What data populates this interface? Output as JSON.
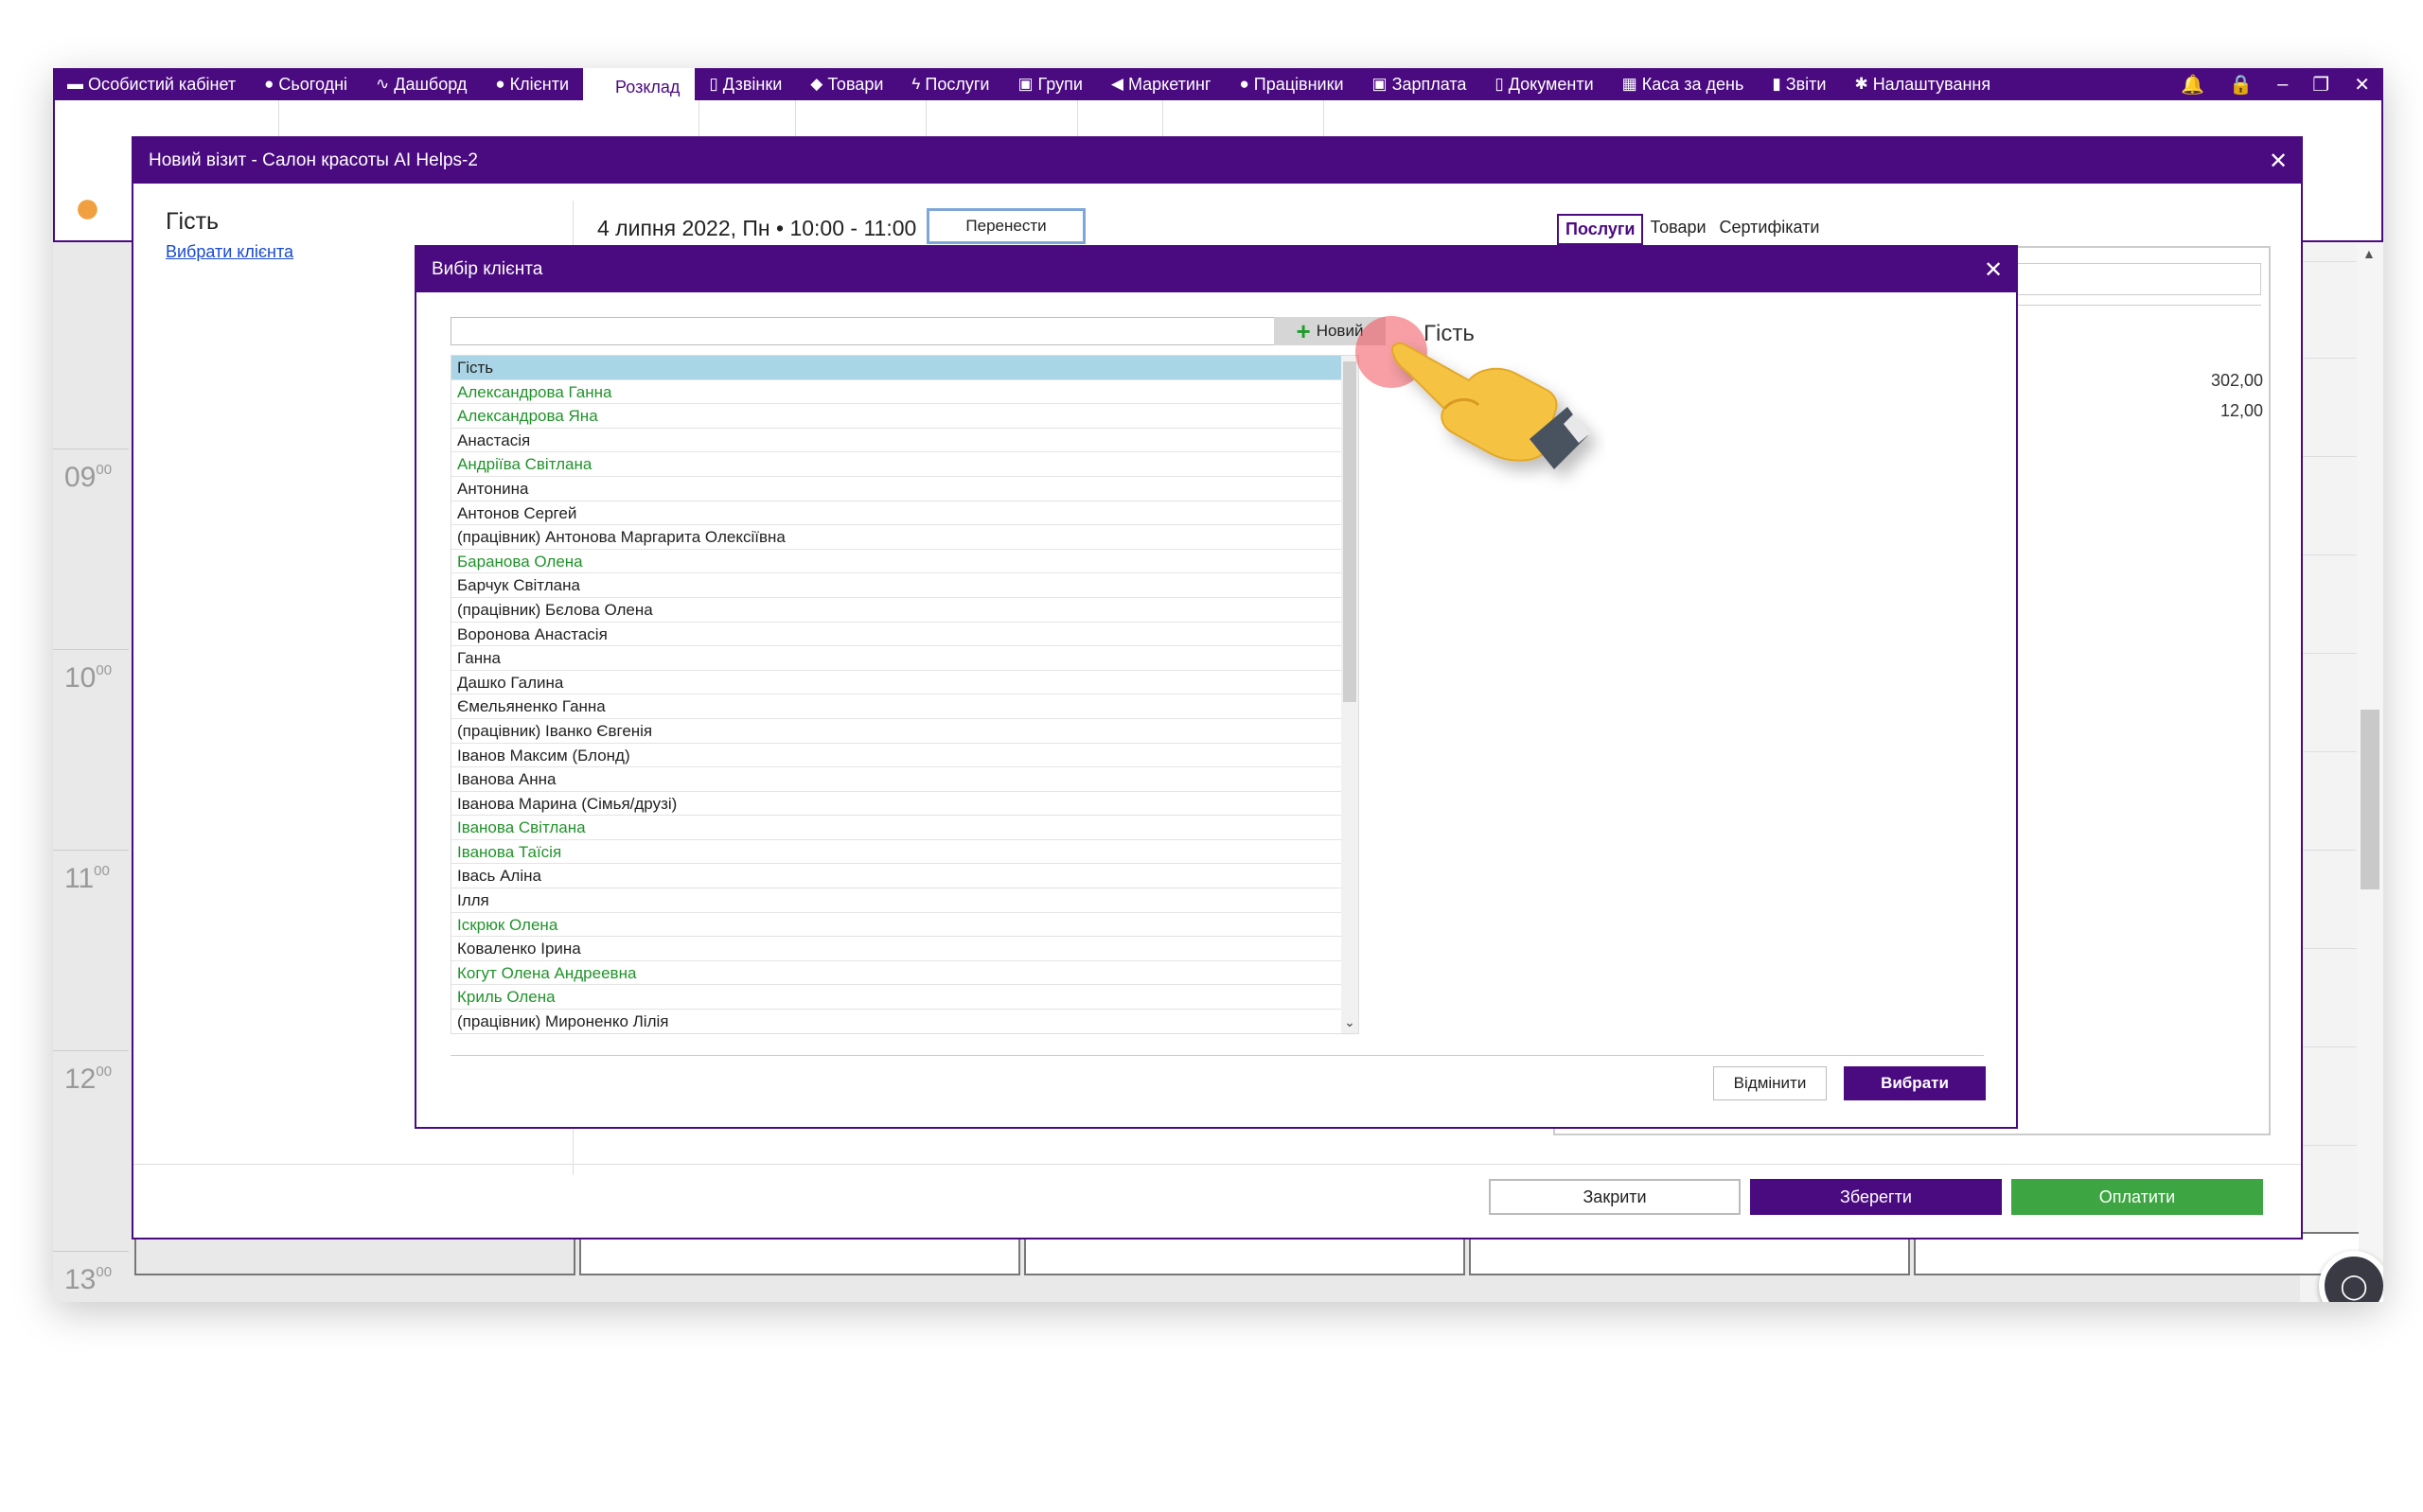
{
  "menu": {
    "items": [
      {
        "label": "Особистий кабінет",
        "icon": "briefcase-icon",
        "glyph": "▬"
      },
      {
        "label": "Сьогодні",
        "icon": "clock-icon",
        "glyph": "●"
      },
      {
        "label": "Дашборд",
        "icon": "pulse-icon",
        "glyph": "∿"
      },
      {
        "label": "Клієнти",
        "icon": "user-circle-icon",
        "glyph": "●"
      },
      {
        "label": "Розклад",
        "icon": "calendar-icon",
        "glyph": "",
        "active": true
      },
      {
        "label": "Дзвінки",
        "icon": "phone-icon",
        "glyph": "▯"
      },
      {
        "label": "Товари",
        "icon": "box-icon",
        "glyph": "◆"
      },
      {
        "label": "Послуги",
        "icon": "lightning-icon",
        "glyph": "ϟ"
      },
      {
        "label": "Групи",
        "icon": "group-icon",
        "glyph": "▣"
      },
      {
        "label": "Маркетинг",
        "icon": "megaphone-icon",
        "glyph": "◀"
      },
      {
        "label": "Працівники",
        "icon": "person-icon",
        "glyph": "●"
      },
      {
        "label": "Зарплата",
        "icon": "money-icon",
        "glyph": "▣"
      },
      {
        "label": "Документи",
        "icon": "document-icon",
        "glyph": "▯"
      },
      {
        "label": "Каса за день",
        "icon": "cash-register-icon",
        "glyph": "▦"
      },
      {
        "label": "Звіти",
        "icon": "bar-chart-icon",
        "glyph": "▮"
      },
      {
        "label": "Налаштування",
        "icon": "gear-icon",
        "glyph": "✱"
      }
    ]
  },
  "calendar": {
    "hours": [
      {
        "h": "09",
        "m": "00"
      },
      {
        "h": "10",
        "m": "00"
      },
      {
        "h": "11",
        "m": "00"
      },
      {
        "h": "12",
        "m": "00"
      },
      {
        "h": "13",
        "m": "00"
      }
    ]
  },
  "visit": {
    "title": "Новий візит - Салон красоты AI Helps-2",
    "client_name": "Гість",
    "choose_client_link": "Вибрати клієнта",
    "datetime": "4 липня 2022, Пн • 10:00 - 11:00",
    "reschedule_label": "Перенести",
    "tabs": [
      "Послуги",
      "Товари",
      "Сертифікати"
    ],
    "amounts": [
      "302,00",
      "12,00"
    ],
    "close_label": "Закрити",
    "save_label": "Зберегти",
    "pay_label": "Оплатити"
  },
  "picker": {
    "title": "Вибір клієнта",
    "search_value": "",
    "new_label": "Новий",
    "preview_name": "Гість",
    "cancel_label": "Відмінити",
    "choose_label": "Вибрати",
    "clients": [
      {
        "name": "Гість",
        "green": false,
        "selected": true
      },
      {
        "name": "Александрова Ганна",
        "green": true
      },
      {
        "name": "Александрова Яна",
        "green": true
      },
      {
        "name": "Анастасія",
        "green": false
      },
      {
        "name": "Андріїва Світлана",
        "green": true
      },
      {
        "name": "Антонина",
        "green": false
      },
      {
        "name": "Антонов Сергей",
        "green": false
      },
      {
        "name": "(працівник) Антонова Маргарита Олексіївна",
        "green": false
      },
      {
        "name": "Баранова Олена",
        "green": true
      },
      {
        "name": "Барчук Світлана",
        "green": false
      },
      {
        "name": "(працівник) Бєлова Олена",
        "green": false
      },
      {
        "name": "Воронова Анастасія",
        "green": false
      },
      {
        "name": "Ганна",
        "green": false
      },
      {
        "name": "Дашко Галина",
        "green": false
      },
      {
        "name": "Ємельяненко Ганна",
        "green": false
      },
      {
        "name": "(працівник) Іванко Євгенія",
        "green": false
      },
      {
        "name": "Іванов Максим (Блонд)",
        "green": false
      },
      {
        "name": "Іванова Анна",
        "green": false
      },
      {
        "name": "Іванова Марина (Сімья/друзі)",
        "green": false
      },
      {
        "name": "Іванова Світлана",
        "green": true
      },
      {
        "name": "Іванова Таїсія",
        "green": true
      },
      {
        "name": "Івась Аліна",
        "green": false
      },
      {
        "name": "Ілля",
        "green": false
      },
      {
        "name": "Іскрюк Олена",
        "green": true
      },
      {
        "name": "Коваленко Ірина",
        "green": false
      },
      {
        "name": "Когут Олена Андреевна",
        "green": true
      },
      {
        "name": "Криль Олена",
        "green": true
      },
      {
        "name": "(працівник) Мироненко Лілія",
        "green": false
      }
    ]
  },
  "colors": {
    "brand": "#4a0a80",
    "green_client": "#21932b",
    "pay": "#3da541",
    "selection": "#a9d5e7"
  }
}
